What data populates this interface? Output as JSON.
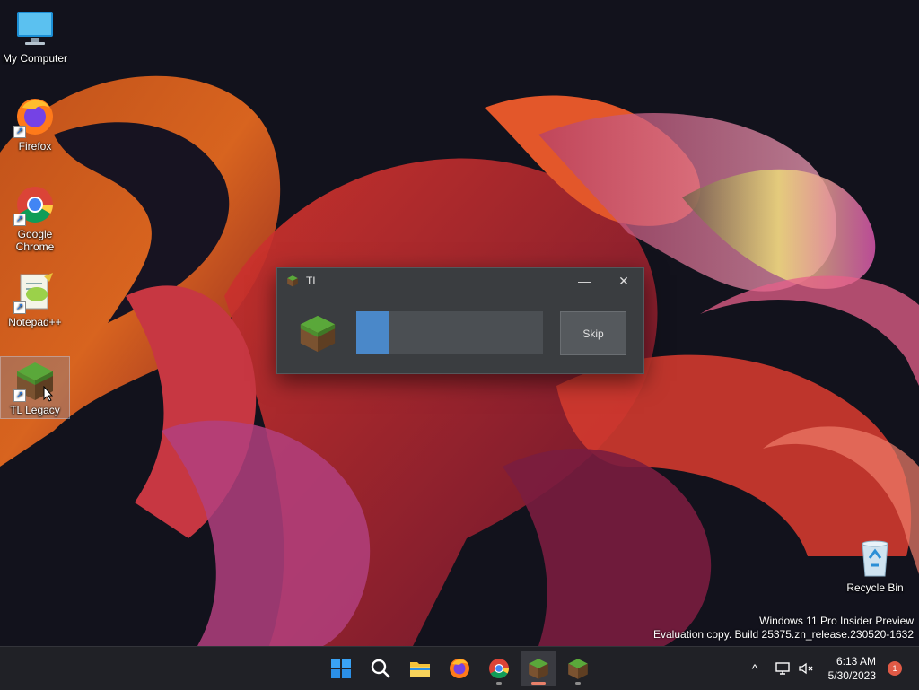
{
  "desktop": {
    "icons": [
      {
        "label": "My Computer",
        "icon": "monitor-icon"
      },
      {
        "label": "Firefox",
        "icon": "firefox-icon"
      },
      {
        "label": "Google Chrome",
        "icon": "chrome-icon"
      },
      {
        "label": "Notepad++",
        "icon": "notepadpp-icon"
      },
      {
        "label": "TL Legacy",
        "icon": "grass-block-icon"
      },
      {
        "label": "Recycle Bin",
        "icon": "recycle-bin-icon"
      }
    ]
  },
  "dialog": {
    "title": "TL",
    "minimize": "—",
    "close": "✕",
    "progress": 0.18,
    "skip_label": "Skip",
    "accent": "#4a88c9"
  },
  "watermark": {
    "line1": "Windows 11 Pro Insider Preview",
    "line2": "Evaluation copy. Build 25375.zn_release.230520-1632"
  },
  "taskbar": {
    "apps": [
      "start-icon",
      "search-icon",
      "file-explorer-icon",
      "firefox-icon",
      "chrome-icon",
      "tl-launcher-icon",
      "minecraft-icon"
    ],
    "tray": {
      "chevron": "^",
      "time": "6:13 AM",
      "date": "5/30/2023",
      "notifications": "1"
    }
  }
}
